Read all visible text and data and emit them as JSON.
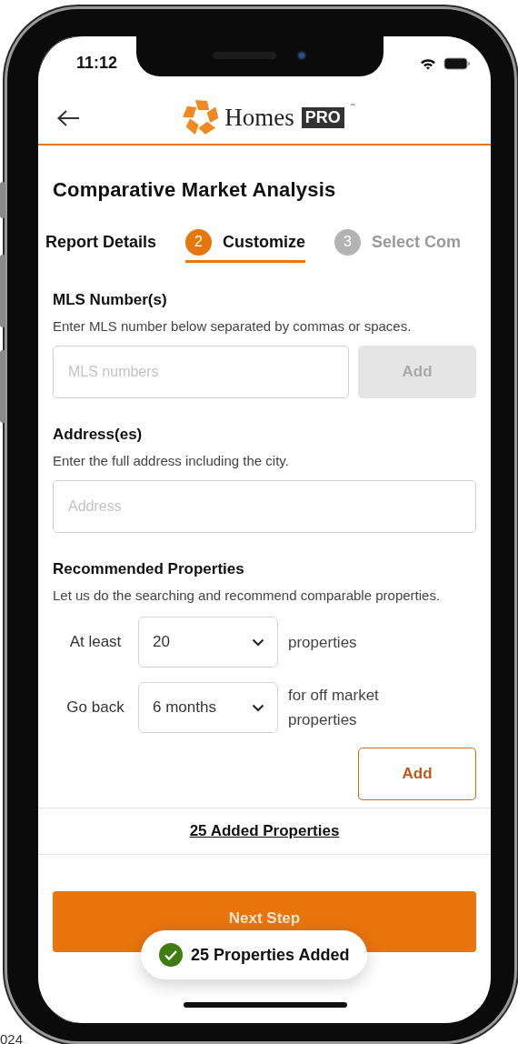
{
  "status_bar": {
    "time": "11:12"
  },
  "header": {
    "brand": "Homes",
    "brand_badge": "PRO",
    "trademark": "™"
  },
  "title": "Comparative Market Analysis",
  "steps": [
    {
      "label": "Report Details",
      "selected": false,
      "completed": true
    },
    {
      "number": "2",
      "label": "Customize",
      "selected": true,
      "completed": false
    },
    {
      "number": "3",
      "label": "Select Com",
      "selected": false,
      "completed": false
    }
  ],
  "mls": {
    "heading": "MLS Number(s)",
    "description": "Enter MLS number below separated by commas or spaces.",
    "placeholder": "MLS numbers",
    "button": {
      "label": "Add",
      "disabled": true
    }
  },
  "address": {
    "heading": "Address(es)",
    "description": "Enter the full address including the city.",
    "placeholder": "Address"
  },
  "recommended": {
    "heading": "Recommended Properties",
    "description": "Let us do the searching and recommend comparable properties.",
    "rows": [
      {
        "prefix": "At least",
        "value": "20",
        "suffix": "properties"
      },
      {
        "prefix": "Go back",
        "value": "6 months",
        "suffix": "for off market properties"
      }
    ],
    "button": {
      "label": "Add",
      "disabled": false
    }
  },
  "added_link": "25 Added Properties",
  "next_button": "Next Step",
  "toast": "25 Properties Added",
  "caption_fragment": "024"
}
